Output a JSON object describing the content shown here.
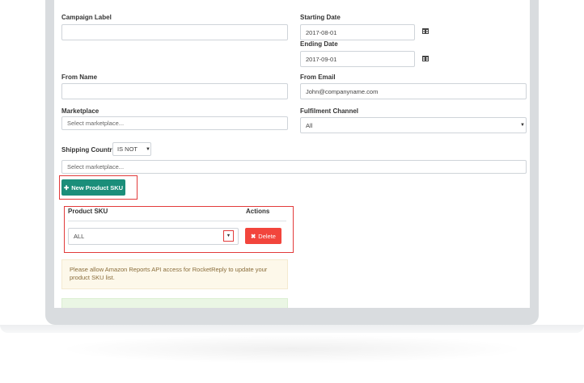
{
  "form": {
    "campaign_label": "Campaign Label",
    "campaign_value": "",
    "starting_date_label": "Starting Date",
    "starting_date_value": "2017-08-01",
    "ending_date_label": "Ending Date",
    "ending_date_value": "2017-09-01",
    "from_name_label": "From Name",
    "from_name_value": "",
    "from_email_label": "From Email",
    "from_email_value": "John@companyname.com",
    "marketplace_label": "Marketplace",
    "marketplace_placeholder": "Select marketplace...",
    "fulfilment_label": "Fulfilment Channel",
    "fulfilment_value": "All",
    "shipping_country_label": "Shipping Country",
    "shipping_operator": "IS NOT",
    "shipping_placeholder": "Select marketplace..."
  },
  "buttons": {
    "new_sku": "New Product SKU",
    "delete": "Delete"
  },
  "sku_table": {
    "col_sku": "Product SKU",
    "col_actions": "Actions",
    "row_value": "ALL"
  },
  "notice": {
    "text": "Please allow Amazon Reports API access for RocketReply to update your product SKU list."
  },
  "icons": {
    "calendar": "calendar-icon",
    "plus": "plus-icon",
    "times": "times-icon",
    "caret": "caret-down-icon"
  },
  "colors": {
    "accent": "#1b8e7a",
    "danger": "#f2453c",
    "highlight": "#e23b3b"
  }
}
